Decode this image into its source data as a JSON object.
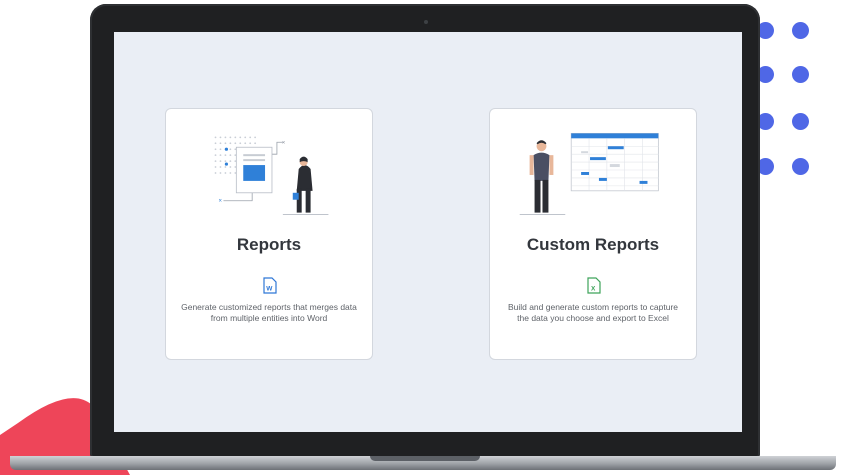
{
  "cards": [
    {
      "title": "Reports",
      "description": "Generate customized reports that merges data from multiple entities into Word",
      "icon": "word-document-icon",
      "icon_color": "#2f77d6"
    },
    {
      "title": "Custom Reports",
      "description": "Build and generate custom reports to capture the data you choose and export to Excel",
      "icon": "excel-document-icon",
      "icon_color": "#3ea35a"
    }
  ],
  "colors": {
    "screen_bg": "#eaeef5",
    "accent_blue": "#2f80d8",
    "dot_blue": "#4f67e6",
    "red_shape": "#ee4559"
  }
}
